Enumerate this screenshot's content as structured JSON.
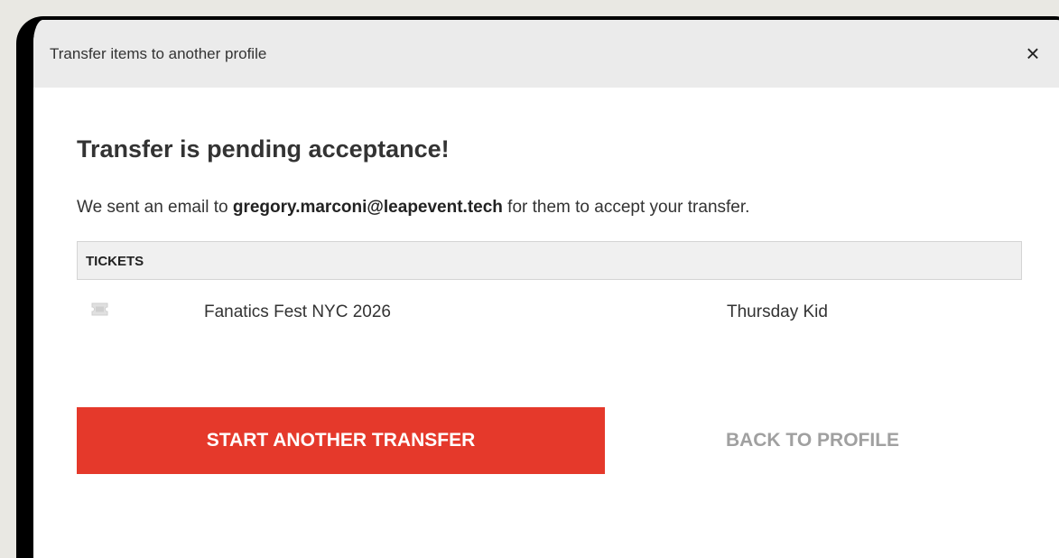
{
  "modal": {
    "title": "Transfer items to another profile",
    "close_symbol": "×"
  },
  "content": {
    "heading": "Transfer is pending acceptance!",
    "message_prefix": "We sent an email to ",
    "email": "gregory.marconi@leapevent.tech",
    "message_suffix": " for them to accept your transfer."
  },
  "tickets": {
    "header": "TICKETS",
    "rows": [
      {
        "icon": "ticket-icon",
        "event": "Fanatics Fest NYC 2026",
        "type": "Thursday Kid"
      }
    ]
  },
  "actions": {
    "primary_label": "START ANOTHER TRANSFER",
    "secondary_label": "BACK TO PROFILE"
  },
  "colors": {
    "primary": "#e5392b",
    "secondary_text": "#a0a0a0",
    "header_bg": "#ebebeb"
  }
}
